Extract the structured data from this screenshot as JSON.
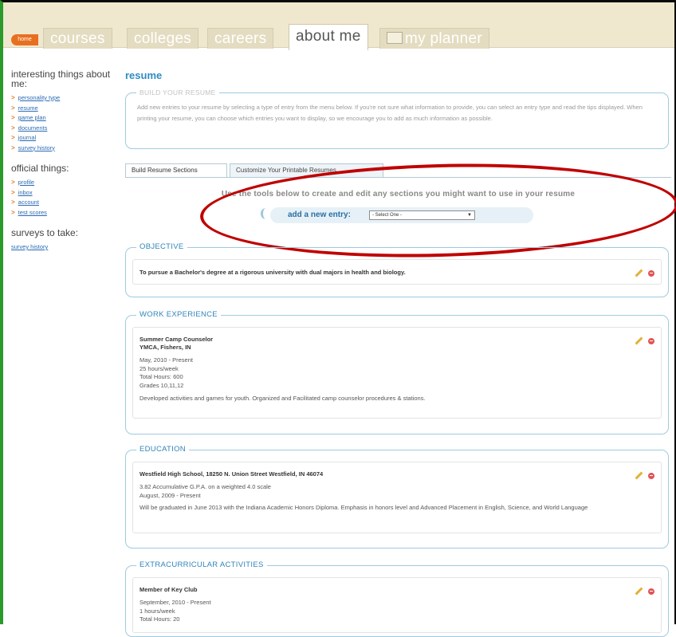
{
  "nav": {
    "home_badge": "home",
    "tabs": [
      {
        "label": "courses",
        "active": false
      },
      {
        "label": "colleges",
        "active": false
      },
      {
        "label": "careers",
        "active": false
      },
      {
        "label": "about me",
        "active": true
      },
      {
        "label": "my planner",
        "active": false
      }
    ]
  },
  "sidebar": {
    "interesting": {
      "heading": "interesting things about me:",
      "items": [
        "personality type",
        "resume",
        "game plan",
        "documents",
        "journal",
        "survey history"
      ]
    },
    "official": {
      "heading": "official things:",
      "items": [
        "profile",
        "inbox",
        "account",
        "test scores"
      ]
    },
    "surveys": {
      "heading": "surveys to take:",
      "items": [
        "survey history"
      ]
    }
  },
  "main": {
    "title": "resume",
    "build": {
      "legend": "BUILD YOUR RESUME",
      "text": "Add new entries to your resume by selecting a type of entry from the menu below. If you're not sure what information to provide, you can select an entry type and read the tips displayed. When printing your resume, you can choose which entries you want to display, so we encourage you to add as much information as possible."
    },
    "tabs": [
      "Build Resume Sections",
      "Customize Your Printable Resumes"
    ],
    "tools_text": "Use the tools below to create and edit any sections you might want to use in your resume",
    "new_entry": {
      "label": "add a new entry:",
      "selected": "- Select One -"
    },
    "sections": {
      "objective": {
        "legend": "OBJECTIVE",
        "text": "To pursue a Bachelor's degree at a rigorous university with dual majors in health and biology."
      },
      "work": {
        "legend": "WORK EXPERIENCE",
        "title": "Summer Camp Counselor",
        "org": "YMCA, Fishers, IN",
        "dates": "May, 2010 - Present",
        "hours": "25 hours/week",
        "total": "Total Hours: 600",
        "grades": "Grades 10,11,12",
        "desc": "Developed activities and games for youth. Organized and Facilitated camp counselor procedures & stations."
      },
      "education": {
        "legend": "EDUCATION",
        "title": "Westfield High School, 18250 N. Union Street Westfield, IN 46074",
        "gpa": "3.82 Accumulative G.P.A. on a weighted 4.0 scale",
        "dates": "August, 2009 - Present",
        "desc": "Will be graduated in June 2013 with the Indiana Academic Honors Diploma. Emphasis in honors level and Advanced Placement in English, Science, and World Language"
      },
      "extracurricular": {
        "legend": "EXTRACURRICULAR ACTIVITIES",
        "title": "Member of Key Club",
        "dates": "September, 2010 - Present",
        "hours": "1 hours/week",
        "total": "Total Hours: 20"
      }
    }
  },
  "colors": {
    "accent_blue": "#2f8cc4",
    "link_blue": "#2a6bb5",
    "arrow_orange": "#e87a1e",
    "highlight_red": "#c00000",
    "left_border_green": "#2a9a2a"
  }
}
